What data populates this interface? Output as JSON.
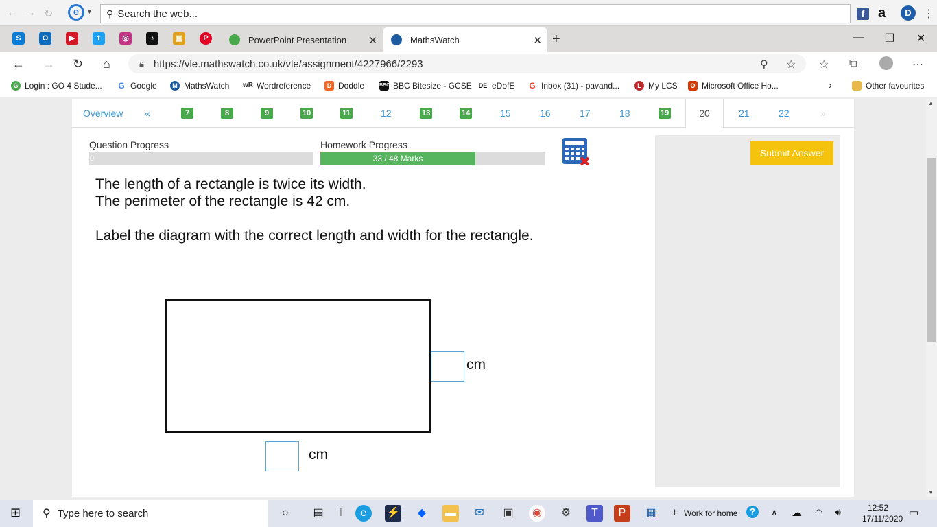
{
  "ie_toolbar": {
    "search_placeholder": "Search the web..."
  },
  "tabs": [
    {
      "title": "PowerPoint Presentation",
      "active": false
    },
    {
      "title": "MathsWatch",
      "active": true
    }
  ],
  "address": {
    "url": "https://vle.mathswatch.co.uk/vle/assignment/4227966/2293"
  },
  "favourites": [
    {
      "label": "Login : GO 4 Stude..."
    },
    {
      "label": "Google"
    },
    {
      "label": "MathsWatch"
    },
    {
      "label": "Wordreference"
    },
    {
      "label": "Doddle"
    },
    {
      "label": "BBC Bitesize - GCSE"
    },
    {
      "label": "eDofE"
    },
    {
      "label": "Inbox (31) - pavand..."
    },
    {
      "label": "My LCS"
    },
    {
      "label": "Microsoft Office Ho..."
    }
  ],
  "favourites_other": "Other favourites",
  "question_nav": {
    "overview": "Overview",
    "prev": "«",
    "next": "»",
    "numbers": [
      "7",
      "8",
      "9",
      "10",
      "11",
      "12",
      "13",
      "14",
      "15",
      "16",
      "17",
      "18",
      "19",
      "20",
      "21",
      "22"
    ],
    "completed": [
      "7",
      "8",
      "9",
      "10",
      "11",
      "13",
      "14",
      "19"
    ],
    "current": "20"
  },
  "progress": {
    "question_label": "Question Progress",
    "question_value": "0",
    "question_fraction": 0,
    "homework_label": "Homework Progress",
    "homework_value": "33 / 48 Marks",
    "homework_fraction": 0.6875
  },
  "submit_label": "Submit Answer",
  "question": {
    "line1": "The length of a rectangle is twice its width.",
    "line2": "The perimeter of the rectangle is 42 cm.",
    "line3": "Label the diagram with the correct length and width for the rectangle.",
    "unit": "cm",
    "answer_height": "",
    "answer_width": ""
  },
  "taskbar": {
    "search_placeholder": "Type here to search",
    "work_label": "Work for home",
    "time": "12:52",
    "date": "17/11/2020"
  },
  "colors": {
    "link": "#3a97d4",
    "completed_green": "#4aa84c",
    "progress_green": "#57b560",
    "submit_yellow": "#f5c30e"
  }
}
